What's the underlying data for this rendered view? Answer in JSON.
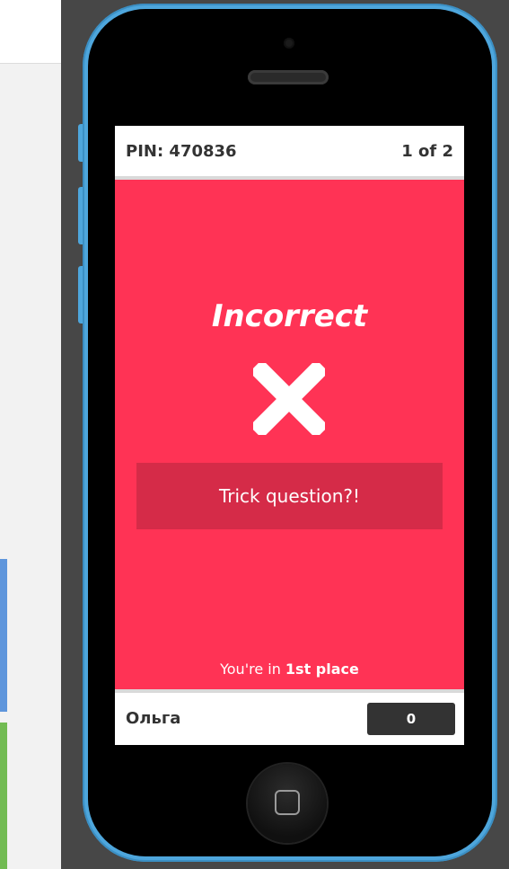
{
  "header": {
    "pin": "PIN: 470836",
    "progress": "1 of 2"
  },
  "result": {
    "title": "Incorrect",
    "icon": "close-icon",
    "answer": "Trick question?!",
    "place_prefix": "You're in ",
    "place_rank": "1st place"
  },
  "footer": {
    "player_name": "Ольга",
    "score": "0"
  },
  "colors": {
    "screen_bg": "#ff3355",
    "answer_bg": "#d52b48",
    "phone_frame": "#4ea6dc",
    "score_bg": "#333333"
  }
}
